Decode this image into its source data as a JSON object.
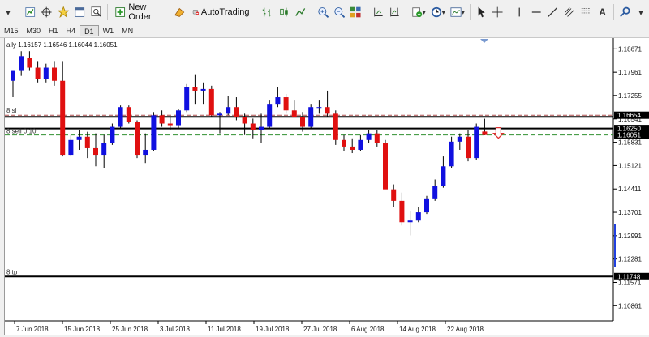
{
  "toolbar": {
    "new_order_label": "New Order",
    "autotrading_label": "AutoTrading",
    "text_tool_label": "A",
    "items": [
      "menu-arrow",
      "new-chart",
      "crosshair-profiles",
      "favorites",
      "chart-window",
      "zoom-window",
      "new-order",
      "metaeditor",
      "autotrading",
      "bar-chart",
      "candlesticks",
      "line-chart",
      "zoom-in",
      "zoom-out",
      "tile-windows",
      "scroll-chart",
      "chart-shift",
      "indicators",
      "periods",
      "templates",
      "cursor",
      "crosshair",
      "vertical-line",
      "horizontal-line",
      "trend-line",
      "fibonacci",
      "gann",
      "text",
      "search"
    ]
  },
  "timeframes": [
    "M15",
    "M30",
    "H1",
    "H4",
    "D1",
    "W1",
    "MN"
  ],
  "active_timeframe": "D1",
  "chart": {
    "ohlc_label": "aily  1.16157 1.16546 1.16044 1.16051",
    "sl_label": "8 sl",
    "sell_label": "8 sell 0.10",
    "tp_label": "8 tp",
    "y_ticks": [
      "1.18671",
      "1.17961",
      "1.17255",
      "1.16541",
      "1.15831",
      "1.15121",
      "1.14411",
      "1.13701",
      "1.12991",
      "1.12281",
      "1.11571",
      "1.10861"
    ],
    "badges": {
      "sl": "1.16654",
      "open": "1.16250",
      "bid": "1.16051",
      "tp": "1.11748"
    },
    "x_labels": [
      "7 Jun 2018",
      "15 Jun 2018",
      "25 Jun 2018",
      "3 Jul 2018",
      "11 Jul 2018",
      "19 Jul 2018",
      "27 Jul 2018",
      "6 Aug 2018",
      "14 Aug 2018",
      "22 Aug 2018"
    ],
    "colors": {
      "bull": "#1010e0",
      "bear": "#e01010",
      "sl": "#b05050",
      "tp": "#b05050",
      "sell": "#309030"
    }
  },
  "chart_data": {
    "type": "candlestick",
    "instrument_timeframe": "Daily",
    "y_range": [
      1.104,
      1.19
    ],
    "levels": {
      "sl": 1.16654,
      "open": 1.1625,
      "bid": 1.16051,
      "tp": 1.11748
    },
    "candles": [
      {
        "o": 1.177,
        "h": 1.18,
        "l": 1.172,
        "c": 1.18
      },
      {
        "o": 1.18,
        "h": 1.186,
        "l": 1.1785,
        "c": 1.1845
      },
      {
        "o": 1.184,
        "h": 1.186,
        "l": 1.18,
        "c": 1.181
      },
      {
        "o": 1.181,
        "h": 1.183,
        "l": 1.1765,
        "c": 1.1775
      },
      {
        "o": 1.1775,
        "h": 1.1822,
        "l": 1.1765,
        "c": 1.181
      },
      {
        "o": 1.181,
        "h": 1.183,
        "l": 1.1755,
        "c": 1.177
      },
      {
        "o": 1.177,
        "h": 1.183,
        "l": 1.154,
        "c": 1.1545
      },
      {
        "o": 1.1545,
        "h": 1.1605,
        "l": 1.154,
        "c": 1.159
      },
      {
        "o": 1.159,
        "h": 1.162,
        "l": 1.156,
        "c": 1.16
      },
      {
        "o": 1.16,
        "h": 1.1615,
        "l": 1.1535,
        "c": 1.1565
      },
      {
        "o": 1.1565,
        "h": 1.161,
        "l": 1.151,
        "c": 1.1545
      },
      {
        "o": 1.1545,
        "h": 1.1605,
        "l": 1.1505,
        "c": 1.158
      },
      {
        "o": 1.158,
        "h": 1.164,
        "l": 1.1575,
        "c": 1.163
      },
      {
        "o": 1.163,
        "h": 1.1695,
        "l": 1.1625,
        "c": 1.169
      },
      {
        "o": 1.169,
        "h": 1.1695,
        "l": 1.164,
        "c": 1.1645
      },
      {
        "o": 1.1645,
        "h": 1.165,
        "l": 1.1535,
        "c": 1.1545
      },
      {
        "o": 1.1545,
        "h": 1.161,
        "l": 1.152,
        "c": 1.156
      },
      {
        "o": 1.156,
        "h": 1.1675,
        "l": 1.1555,
        "c": 1.1665
      },
      {
        "o": 1.1665,
        "h": 1.168,
        "l": 1.163,
        "c": 1.164
      },
      {
        "o": 1.164,
        "h": 1.166,
        "l": 1.162,
        "c": 1.1635
      },
      {
        "o": 1.1635,
        "h": 1.1685,
        "l": 1.1625,
        "c": 1.168
      },
      {
        "o": 1.168,
        "h": 1.176,
        "l": 1.1675,
        "c": 1.175
      },
      {
        "o": 1.175,
        "h": 1.179,
        "l": 1.17,
        "c": 1.174
      },
      {
        "o": 1.174,
        "h": 1.1765,
        "l": 1.17,
        "c": 1.1745
      },
      {
        "o": 1.1745,
        "h": 1.1755,
        "l": 1.166,
        "c": 1.1665
      },
      {
        "o": 1.1665,
        "h": 1.1675,
        "l": 1.161,
        "c": 1.167
      },
      {
        "o": 1.167,
        "h": 1.1725,
        "l": 1.1665,
        "c": 1.169
      },
      {
        "o": 1.169,
        "h": 1.172,
        "l": 1.165,
        "c": 1.166
      },
      {
        "o": 1.166,
        "h": 1.167,
        "l": 1.1605,
        "c": 1.164
      },
      {
        "o": 1.164,
        "h": 1.1655,
        "l": 1.1595,
        "c": 1.162
      },
      {
        "o": 1.162,
        "h": 1.167,
        "l": 1.158,
        "c": 1.163
      },
      {
        "o": 1.163,
        "h": 1.171,
        "l": 1.1625,
        "c": 1.17
      },
      {
        "o": 1.17,
        "h": 1.175,
        "l": 1.169,
        "c": 1.172
      },
      {
        "o": 1.172,
        "h": 1.173,
        "l": 1.167,
        "c": 1.168
      },
      {
        "o": 1.168,
        "h": 1.171,
        "l": 1.1665,
        "c": 1.166
      },
      {
        "o": 1.166,
        "h": 1.1675,
        "l": 1.1615,
        "c": 1.163
      },
      {
        "o": 1.163,
        "h": 1.17,
        "l": 1.1625,
        "c": 1.169
      },
      {
        "o": 1.169,
        "h": 1.171,
        "l": 1.167,
        "c": 1.169
      },
      {
        "o": 1.169,
        "h": 1.174,
        "l": 1.166,
        "c": 1.167
      },
      {
        "o": 1.167,
        "h": 1.168,
        "l": 1.1575,
        "c": 1.159
      },
      {
        "o": 1.159,
        "h": 1.1605,
        "l": 1.1555,
        "c": 1.157
      },
      {
        "o": 1.157,
        "h": 1.1595,
        "l": 1.155,
        "c": 1.156
      },
      {
        "o": 1.156,
        "h": 1.1605,
        "l": 1.1555,
        "c": 1.159
      },
      {
        "o": 1.159,
        "h": 1.162,
        "l": 1.158,
        "c": 1.161
      },
      {
        "o": 1.161,
        "h": 1.162,
        "l": 1.157,
        "c": 1.158
      },
      {
        "o": 1.158,
        "h": 1.159,
        "l": 1.1455,
        "c": 1.144
      },
      {
        "o": 1.144,
        "h": 1.1455,
        "l": 1.1385,
        "c": 1.1405
      },
      {
        "o": 1.1405,
        "h": 1.143,
        "l": 1.133,
        "c": 1.134
      },
      {
        "o": 1.134,
        "h": 1.1375,
        "l": 1.13,
        "c": 1.1345
      },
      {
        "o": 1.1345,
        "h": 1.1385,
        "l": 1.134,
        "c": 1.137
      },
      {
        "o": 1.137,
        "h": 1.142,
        "l": 1.1365,
        "c": 1.141
      },
      {
        "o": 1.141,
        "h": 1.147,
        "l": 1.1405,
        "c": 1.145
      },
      {
        "o": 1.145,
        "h": 1.154,
        "l": 1.1445,
        "c": 1.151
      },
      {
        "o": 1.151,
        "h": 1.16,
        "l": 1.1505,
        "c": 1.1585
      },
      {
        "o": 1.1585,
        "h": 1.161,
        "l": 1.156,
        "c": 1.16
      },
      {
        "o": 1.16,
        "h": 1.162,
        "l": 1.1525,
        "c": 1.1535
      },
      {
        "o": 1.1535,
        "h": 1.164,
        "l": 1.153,
        "c": 1.163
      },
      {
        "o": 1.16157,
        "h": 1.16546,
        "l": 1.16044,
        "c": 1.16051
      }
    ]
  }
}
